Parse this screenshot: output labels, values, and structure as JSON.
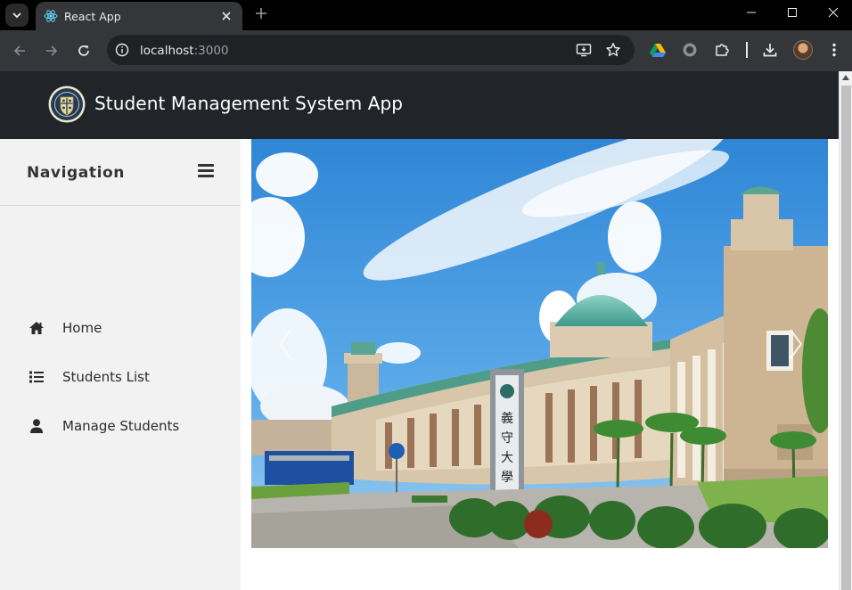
{
  "browser": {
    "tab_title": "React App",
    "url_host": "localhost",
    "url_port": ":3000",
    "icons": [
      "tab-search-icon",
      "react-favicon",
      "close-icon",
      "new-tab-icon",
      "minimize-icon",
      "maximize-icon",
      "window-close-icon",
      "back-icon",
      "forward-icon",
      "reload-icon",
      "site-info-icon",
      "install-app-icon",
      "bookmark-star-icon",
      "google-drive-icon",
      "extension-circle-icon",
      "extensions-puzzle-icon",
      "download-icon",
      "profile-avatar",
      "menu-kebab-icon"
    ]
  },
  "app": {
    "title": "Student Management System App",
    "logo_icon": "university-seal-logo"
  },
  "sidebar": {
    "title": "Navigation",
    "toggle_icon": "hamburger-icon",
    "items": [
      {
        "label": "Home",
        "icon": "home-icon"
      },
      {
        "label": "Students List",
        "icon": "list-icon"
      },
      {
        "label": "Manage Students",
        "icon": "user-icon"
      }
    ]
  },
  "carousel": {
    "image_description_icon": "campus-photo",
    "prev_icon": "chevron-left-icon",
    "next_icon": "chevron-right-icon"
  },
  "colors": {
    "header_bg": "#212529",
    "sidebar_bg": "#f2f2f2",
    "chrome_bg": "#35363a"
  }
}
